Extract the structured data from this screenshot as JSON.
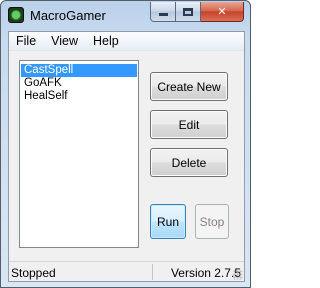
{
  "window": {
    "title": "MacroGamer",
    "icon": "macrogamer-app-icon",
    "caption": {
      "minimize": "minimize-icon",
      "maximize": "maximize-icon",
      "close_glyph": "✕"
    }
  },
  "menubar": {
    "items": [
      {
        "label": "File"
      },
      {
        "label": "View"
      },
      {
        "label": "Help"
      }
    ]
  },
  "macro_list": {
    "items": [
      {
        "label": "CastSpell",
        "selected": true
      },
      {
        "label": "GoAFK",
        "selected": false
      },
      {
        "label": "HealSelf",
        "selected": false
      }
    ]
  },
  "buttons": {
    "create_new": "Create New",
    "edit": "Edit",
    "delete": "Delete",
    "run": "Run",
    "stop": "Stop"
  },
  "statusbar": {
    "status": "Stopped",
    "version": "Version 2.7.5"
  },
  "colors": {
    "selection": "#3399ff",
    "run_accent": "#3c7fb1",
    "close_button": "#c7432a"
  }
}
